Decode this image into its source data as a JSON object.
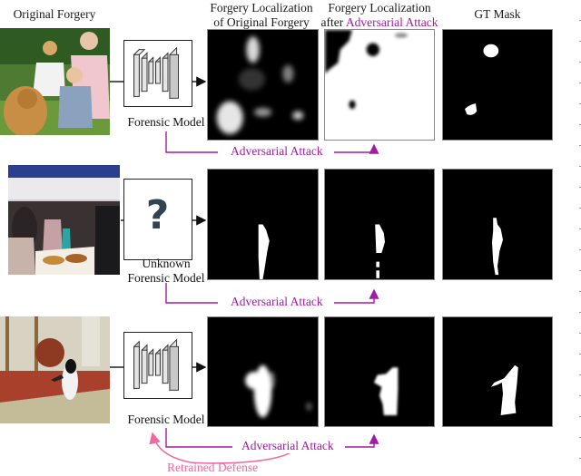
{
  "headers": {
    "original": "Original Forgery",
    "loc_original_line1": "Forgery Localization",
    "loc_original_line2": "of Original Forgery",
    "loc_attack_line1": "Forgery Localization",
    "loc_attack_prefix": "after ",
    "loc_attack_highlight": "Adversarial Attack",
    "gt": "GT Mask"
  },
  "rows": [
    {
      "photo": "family-photo-with-dog",
      "model_label": "Forensic Model",
      "model_icon": "neural-network-icon",
      "attack_label": "Adversarial Attack"
    },
    {
      "photo": "buffet-crowd-photo",
      "model_label_line1": "Unknown",
      "model_label_line2": "Forensic Model",
      "model_icon": "question-mark-icon",
      "attack_label": "Adversarial Attack"
    },
    {
      "photo": "penguin-in-room-photo",
      "model_label": "Forensic Model",
      "model_icon": "neural-network-icon",
      "attack_label": "Adversarial Attack",
      "defense_label": "Retrained Defense"
    }
  ],
  "colors": {
    "attack": "#a11ba6",
    "defense": "#f06aa0"
  }
}
